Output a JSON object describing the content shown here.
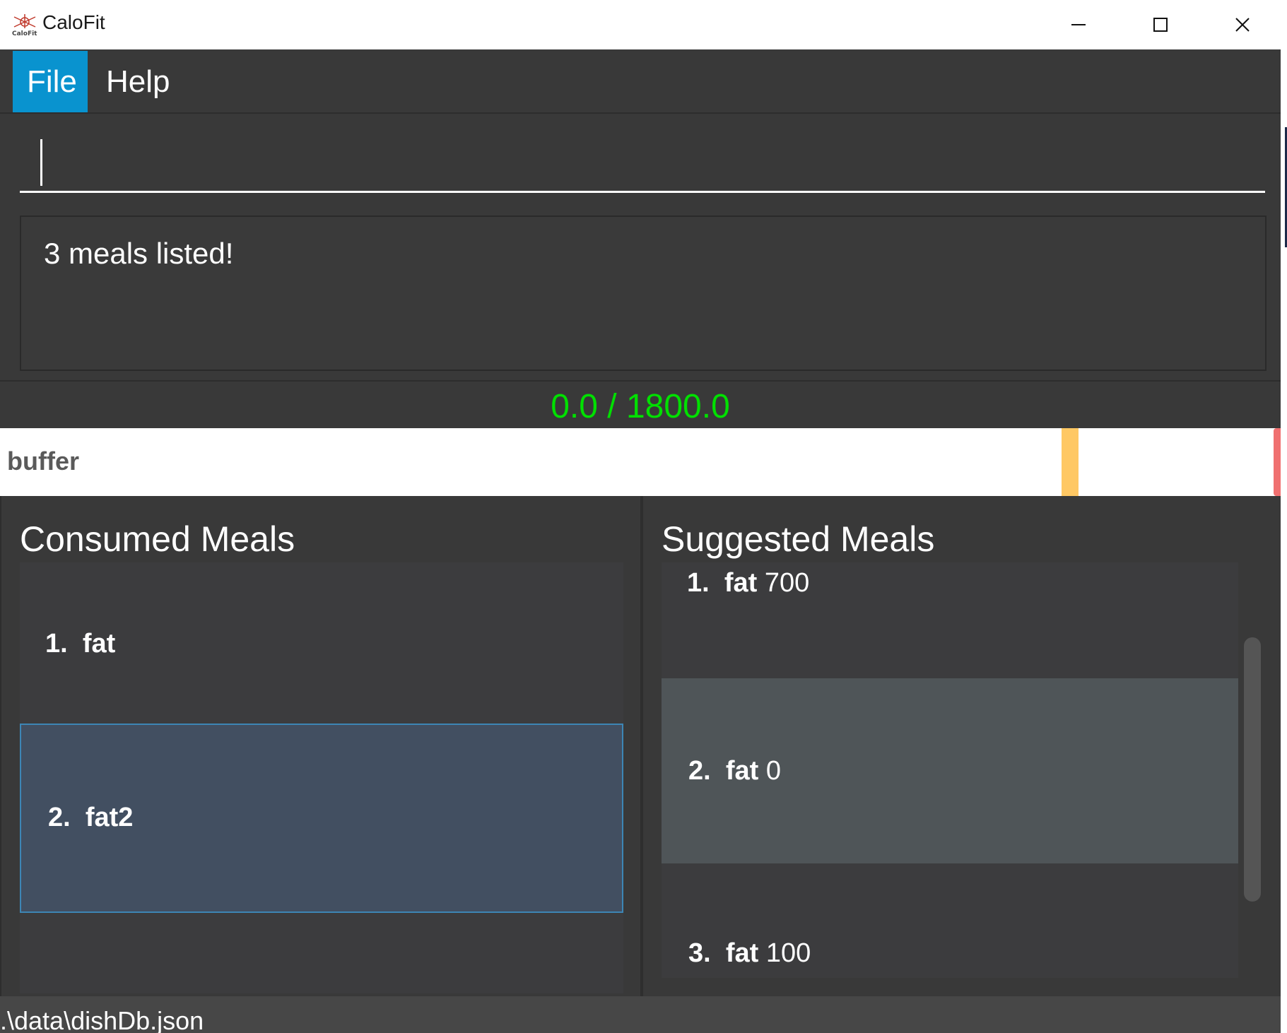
{
  "window": {
    "title": "CaloFit",
    "logo_icon": "calofit-logo-icon",
    "logo_text": "CaloFit",
    "controls": [
      "minimize-icon",
      "maximize-icon",
      "close-icon"
    ]
  },
  "menu": {
    "items": [
      {
        "label": "File",
        "active": true
      },
      {
        "label": "Help",
        "active": false
      }
    ]
  },
  "command": {
    "value": "",
    "placeholder": ""
  },
  "result": {
    "text": "3 meals listed!"
  },
  "calories": {
    "readout": "0.0 / 1800.0",
    "color": "#00e000"
  },
  "progress": {
    "label": "buffer",
    "value": 0.0,
    "target": 1800.0,
    "marker_color": "#ffc864",
    "end_color": "#f07070"
  },
  "consumed": {
    "title": "Consumed Meals",
    "items": [
      {
        "index": "1.",
        "name": "fat",
        "selected": false
      },
      {
        "index": "2.",
        "name": "fat2",
        "selected": true
      }
    ]
  },
  "suggested": {
    "title": "Suggested Meals",
    "items": [
      {
        "index": "1.",
        "name": "fat",
        "calories": "700"
      },
      {
        "index": "2.",
        "name": "fat",
        "calories": "0"
      },
      {
        "index": "3.",
        "name": "fat",
        "calories": "100"
      }
    ]
  },
  "status": {
    "path": ".\\data\\dishDb.json"
  },
  "colors": {
    "accent": "#0993cf",
    "panel": "#393939",
    "selection": "#424f61"
  }
}
